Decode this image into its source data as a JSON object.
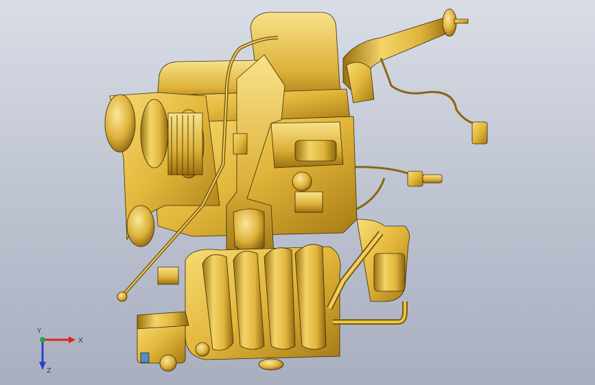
{
  "viewport": {
    "triad": {
      "x_label": "X",
      "y_label": "Y",
      "z_label": "Z",
      "x_color": "#e32020",
      "y_color": "#1fa83a",
      "z_color": "#2a3fd1"
    },
    "model": {
      "name_icon": "engine-assembly-3d-model",
      "color": "#e9c344"
    }
  }
}
